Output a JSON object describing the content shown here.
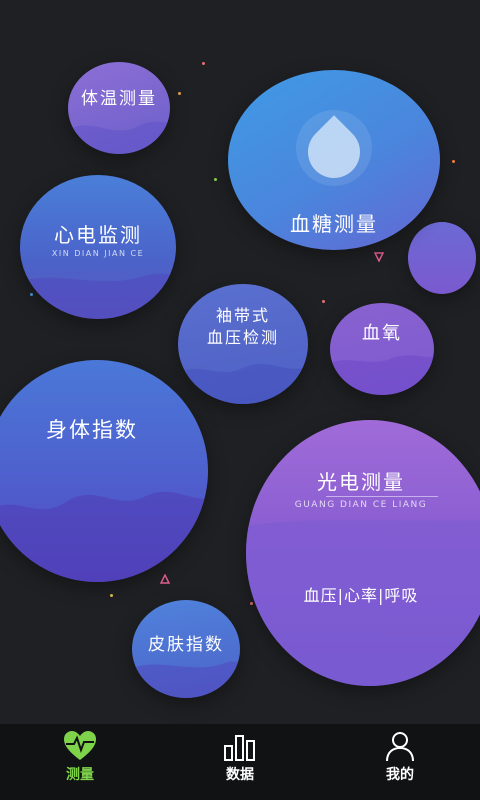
{
  "bubbles": {
    "temperature": {
      "title": "体温测量"
    },
    "ecg": {
      "title": "心电监测",
      "subtitle": "XIN DIAN JIAN CE"
    },
    "blood_sugar": {
      "title": "血糖测量"
    },
    "cuff_bp": {
      "title_line1": "袖带式",
      "title_line2": "血压检测"
    },
    "blood_oxygen": {
      "title": "血氧"
    },
    "body_index": {
      "title": "身体指数"
    },
    "photoelectric": {
      "title": "光电测量",
      "subtitle": "GUANG DIAN CE LIANG",
      "detail": "血压|心率|呼吸"
    },
    "skin_index": {
      "title": "皮肤指数"
    }
  },
  "tabs": [
    {
      "label": "测量",
      "icon": "heart-pulse-icon",
      "active": true
    },
    {
      "label": "数据",
      "icon": "bar-chart-icon",
      "active": false
    },
    {
      "label": "我的",
      "icon": "user-icon",
      "active": false
    }
  ],
  "colors": {
    "background": "#1f2023",
    "tabbar": "#111214",
    "active_tab": "#7ed34b"
  }
}
